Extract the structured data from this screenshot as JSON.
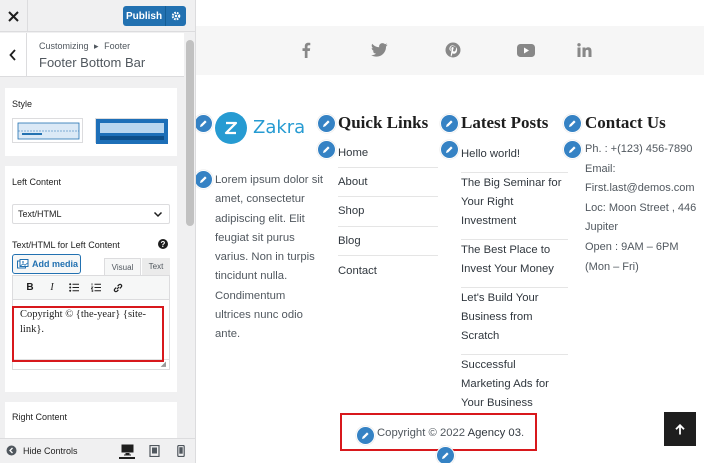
{
  "customizer": {
    "close_icon": "close-icon",
    "publish_label": "Publish",
    "breadcrumb_root": "Customizing",
    "breadcrumb_sep": "▸",
    "breadcrumb_parent": "Footer",
    "section_title": "Footer Bottom Bar",
    "style_label": "Style",
    "style_options": [
      "layout-style-1",
      "layout-style-2"
    ],
    "style_selected": 0,
    "left_content_label": "Left Content",
    "left_content_value": "Text/HTML",
    "text_html_label": "Text/HTML for Left Content",
    "add_media_label": "Add media",
    "tab_visual": "Visual",
    "tab_text": "Text",
    "toolbar_buttons": [
      "bold",
      "italic",
      "bullet-list",
      "numbered-list",
      "link"
    ],
    "editor_content": "Copyright © {the-year} {site-link}.",
    "right_content_label": "Right Content",
    "hide_controls_label": "Hide Controls",
    "devices": [
      "desktop",
      "tablet",
      "mobile"
    ],
    "active_device": "desktop",
    "accent_color": "#2271b1",
    "highlight_color": "#d8181c"
  },
  "preview": {
    "social_icons": [
      "facebook-icon",
      "twitter-icon",
      "pinterest-icon",
      "youtube-icon",
      "linkedin-icon"
    ],
    "logo_text": "Zakra",
    "logo_color": "#269bd2",
    "about_text": "Lorem ipsum dolor sit amet, consectetur adipiscing elit. Elit feugiat sit purus varius. Non in turpis tincidunt nulla. Condimentum ultrices nunc odio ante.",
    "quick_links": {
      "title": "Quick Links",
      "items": [
        "Home",
        "About",
        "Shop",
        "Blog",
        "Contact"
      ]
    },
    "latest_posts": {
      "title": "Latest Posts",
      "items": [
        "Hello world!",
        "The Big Seminar for Your Right Investment",
        "The Best Place to Invest Your Money",
        "Let's Build Your Business from Scratch",
        "Successful Marketing Ads for Your Business"
      ]
    },
    "contact": {
      "title": "Contact Us",
      "lines": [
        "Ph. : +(123) 456-7890",
        "Email: First.last@demos.com",
        "Loc: Moon Street , 446 Jupiter",
        "Open : 9AM – 6PM (Mon – Fri)"
      ]
    },
    "copyright_prefix": "Copyright © 2022 ",
    "copyright_link": "Agency 03",
    "copyright_suffix": ".",
    "edit_icon": "pencil-icon",
    "scroll_top_icon": "arrow-up-icon"
  }
}
